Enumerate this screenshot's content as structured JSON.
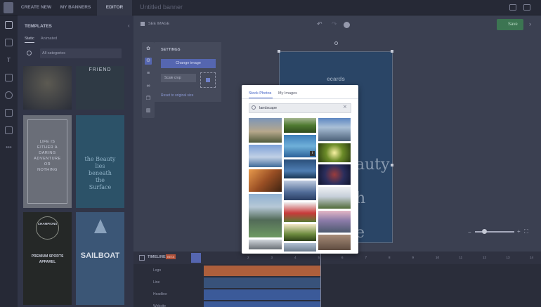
{
  "topbar": {
    "nav": [
      "CREATE NEW",
      "MY BANNERS",
      "EDITOR"
    ],
    "title": "Untitled banner"
  },
  "panel": {
    "title": "TEMPLATES",
    "tabs": [
      "Static",
      "Animated"
    ],
    "category": "All categories",
    "templates": [
      {
        "lines": [
          "FRIEND"
        ]
      },
      {
        "lines": [
          "LIFE IS",
          "EITHER A",
          "DARING",
          "ADVENTURE",
          "OR",
          "NOTHING"
        ]
      },
      {
        "lines": [
          "the Beauty",
          "lies",
          "beneath",
          "the",
          "Surface"
        ]
      },
      {
        "lines": [
          "CHAMPIONS",
          "PREMIUM SPORTS",
          "APPAREL"
        ]
      },
      {
        "lines": [
          "SAILBOAT"
        ]
      }
    ]
  },
  "toolbar": {
    "download_label": "SEE IMAGE",
    "save_label": "Save"
  },
  "settings": {
    "title": "SETTINGS",
    "change_image": "Change image",
    "scale": "Scale crop",
    "reset": "Reset to original size"
  },
  "canvas": {
    "logo_text": "ecards",
    "text_fragments": [
      "auty",
      "h",
      "e"
    ]
  },
  "timeline": {
    "title": "TIMELINE",
    "badge": "BETA",
    "ticks": [
      "2",
      "3",
      "4",
      "5",
      "6",
      "7",
      "8",
      "9",
      "10",
      "11",
      "12",
      "13",
      "14"
    ],
    "tracks": [
      "Logo",
      "Line",
      "Headline",
      "Website"
    ]
  },
  "modal": {
    "tabs": [
      "Stock Photos",
      "My Images"
    ],
    "search_value": "landscape"
  },
  "colors": {
    "accent": "#3d5dc4",
    "save": "#3c7552",
    "banner": "#2a4566"
  }
}
